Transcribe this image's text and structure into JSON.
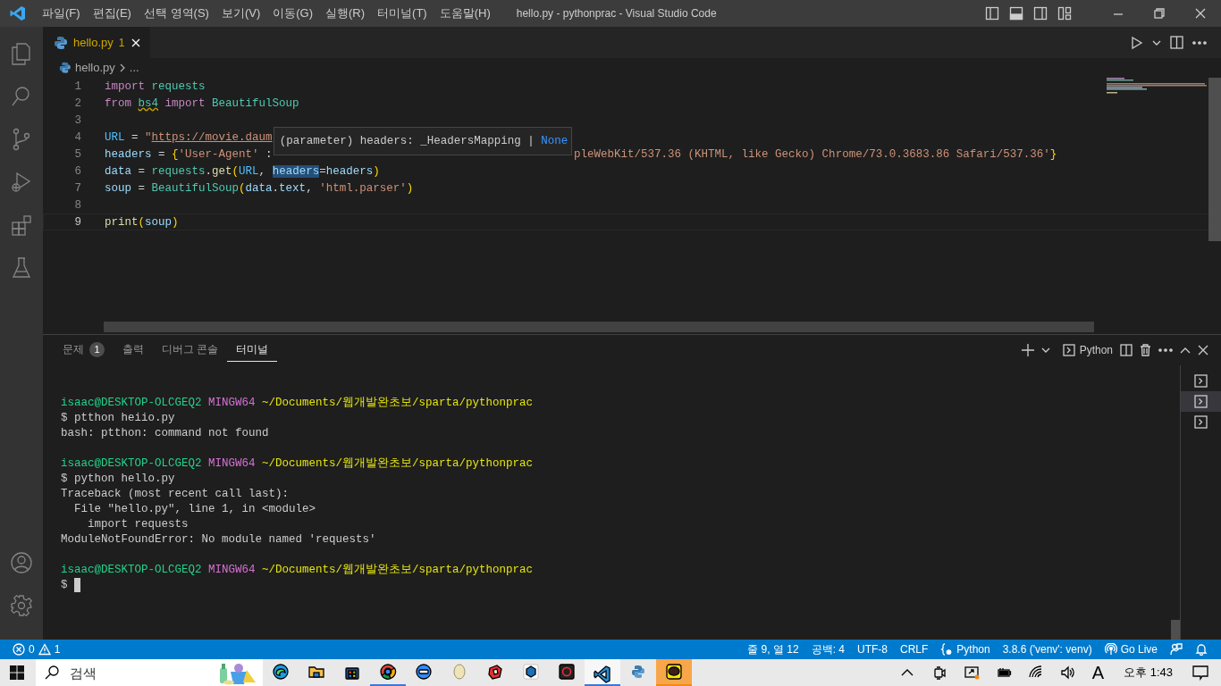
{
  "title_bar": {
    "menus": [
      "파일(F)",
      "편집(E)",
      "선택 영역(S)",
      "보기(V)",
      "이동(G)",
      "실행(R)",
      "터미널(T)",
      "도움말(H)"
    ],
    "title": "hello.py - pythonprac - Visual Studio Code"
  },
  "activity_bar": {
    "items": [
      {
        "kind": "files"
      },
      {
        "kind": "search"
      },
      {
        "kind": "source_control"
      },
      {
        "kind": "run_debug"
      },
      {
        "kind": "extensions"
      },
      {
        "kind": "testing"
      }
    ],
    "bottom": [
      {
        "kind": "account"
      },
      {
        "kind": "settings"
      }
    ]
  },
  "editor": {
    "tabs": [
      {
        "label": "hello.py",
        "problems": "1",
        "selected": true
      }
    ],
    "breadcrumb": [
      "hello.py",
      "..."
    ],
    "lines": [
      {
        "number": "1",
        "current": false,
        "tokens": [
          {
            "kind": "keyword",
            "t": "import "
          },
          {
            "kind": "type",
            "t": "requests"
          }
        ]
      },
      {
        "number": "2",
        "current": false,
        "tokens": [
          {
            "kind": "keyword",
            "t": "from "
          },
          {
            "kind": "type_warning",
            "t": "bs4"
          },
          {
            "kind": "keyword",
            "t": " import "
          },
          {
            "kind": "type",
            "t": "BeautifulSoup"
          }
        ]
      },
      {
        "number": "3",
        "current": false
      },
      {
        "number": "4",
        "current": false,
        "tokens": [
          {
            "kind": "const",
            "t": "URL"
          },
          {
            "kind": "plain",
            "t": " = "
          },
          {
            "kind": "string",
            "t": "\""
          },
          {
            "kind": "url",
            "t": "https://movie.daum"
          }
        ]
      },
      {
        "number": "5",
        "current": false,
        "tokens": [
          {
            "kind": "var",
            "t": "headers"
          },
          {
            "kind": "plain",
            "t": " = "
          },
          {
            "kind": "bracket",
            "t": "{"
          },
          {
            "kind": "string",
            "t": "'User-Agent'"
          },
          {
            "kind": "plain",
            "t": " :"
          }
        ],
        "tail": [
          {
            "kind": "string",
            "t": "pleWebKit/537.36 (KHTML, like Gecko) Chrome/73.0.3683.86 Safari/537.36'"
          },
          {
            "kind": "bracket",
            "t": "}"
          }
        ]
      },
      {
        "number": "6",
        "current": false,
        "tokens": [
          {
            "kind": "var",
            "t": "data"
          },
          {
            "kind": "plain",
            "t": " = "
          },
          {
            "kind": "type",
            "t": "requests"
          },
          {
            "kind": "plain",
            "t": "."
          },
          {
            "kind": "function",
            "t": "get"
          },
          {
            "kind": "bracket",
            "t": "("
          },
          {
            "kind": "const",
            "t": "URL"
          },
          {
            "kind": "plain",
            "t": ", "
          },
          {
            "kind": "highlight",
            "t": "headers"
          },
          {
            "kind": "plain",
            "t": "="
          },
          {
            "kind": "var",
            "t": "headers"
          },
          {
            "kind": "bracket",
            "t": ")"
          }
        ]
      },
      {
        "number": "7",
        "current": false,
        "tokens": [
          {
            "kind": "var",
            "t": "soup"
          },
          {
            "kind": "plain",
            "t": " = "
          },
          {
            "kind": "type",
            "t": "BeautifulSoup"
          },
          {
            "kind": "bracket",
            "t": "("
          },
          {
            "kind": "var",
            "t": "data"
          },
          {
            "kind": "plain",
            "t": "."
          },
          {
            "kind": "var",
            "t": "text"
          },
          {
            "kind": "plain",
            "t": ", "
          },
          {
            "kind": "string",
            "t": "'html.parser'"
          },
          {
            "kind": "bracket",
            "t": ")"
          }
        ]
      },
      {
        "number": "8",
        "current": false
      },
      {
        "number": "9",
        "current": true,
        "tokens": [
          {
            "kind": "function",
            "t": "print"
          },
          {
            "kind": "bracket",
            "t": "("
          },
          {
            "kind": "var",
            "t": "soup"
          },
          {
            "kind": "bracket",
            "t": ")"
          }
        ]
      }
    ],
    "hover": {
      "signature": "(parameter) headers: _HeadersMapping | ",
      "type": "None"
    }
  },
  "panel": {
    "tabs": [
      {
        "label": "문제",
        "badge": "1",
        "selected": false
      },
      {
        "label": "출력",
        "selected": false
      },
      {
        "label": "디버그 콘솔",
        "selected": false
      },
      {
        "label": "터미널",
        "selected": true
      }
    ],
    "profile": "Python",
    "terminal_lines": [
      {
        "segments": [
          {
            "kind": "user",
            "t": "isaac@DESKTOP-OLCGEQ2"
          },
          {
            "kind": "host",
            "t": " MINGW64"
          },
          {
            "kind": "path",
            "t": " ~/Documents/웹개발완초보/sparta/pythonprac"
          }
        ]
      },
      {
        "segments": [
          {
            "kind": "plain",
            "t": "$ ptthon heiio.py"
          }
        ]
      },
      {
        "segments": [
          {
            "kind": "plain",
            "t": "bash: ptthon: command not found"
          }
        ]
      },
      {
        "after_blank": true,
        "segments": [
          {
            "kind": "user",
            "t": "isaac@DESKTOP-OLCGEQ2"
          },
          {
            "kind": "host",
            "t": " MINGW64"
          },
          {
            "kind": "path",
            "t": " ~/Documents/웹개발완초보/sparta/pythonprac"
          }
        ]
      },
      {
        "segments": [
          {
            "kind": "plain",
            "t": "$ python hello.py"
          }
        ]
      },
      {
        "segments": [
          {
            "kind": "plain",
            "t": "Traceback (most recent call last):"
          }
        ]
      },
      {
        "segments": [
          {
            "kind": "plain",
            "t": "  File \"hello.py\", line 1, in <module>"
          }
        ]
      },
      {
        "segments": [
          {
            "kind": "plain",
            "t": "    import requests"
          }
        ]
      },
      {
        "segments": [
          {
            "kind": "plain",
            "t": "ModuleNotFoundError: No module named 'requests'"
          }
        ]
      },
      {
        "after_blank": true,
        "segments": [
          {
            "kind": "user",
            "t": "isaac@DESKTOP-OLCGEQ2"
          },
          {
            "kind": "host",
            "t": " MINGW64"
          },
          {
            "kind": "path",
            "t": " ~/Documents/웹개발완초보/sparta/pythonprac"
          }
        ]
      },
      {
        "segments": [
          {
            "kind": "plain",
            "t": "$"
          }
        ],
        "cursor": true
      }
    ],
    "terminals": [
      {
        "selected": false
      },
      {
        "selected": true
      },
      {
        "selected": false
      }
    ]
  },
  "status_bar": {
    "left": [
      {
        "kind": "errors",
        "text": "0"
      },
      {
        "kind": "warnings",
        "text": "1"
      }
    ],
    "right": [
      {
        "kind": "text",
        "text": "줄 9, 열 12"
      },
      {
        "kind": "text",
        "text": "공백: 4"
      },
      {
        "kind": "text",
        "text": "UTF-8"
      },
      {
        "kind": "text",
        "text": "CRLF"
      },
      {
        "kind": "language",
        "text": "Python"
      },
      {
        "kind": "text",
        "text": "3.8.6 ('venv': venv)"
      },
      {
        "kind": "golive",
        "text": "Go Live"
      },
      {
        "kind": "feedback"
      },
      {
        "kind": "bell"
      }
    ]
  },
  "taskbar": {
    "search_placeholder": "검색",
    "apps": [
      {
        "kind": "edge",
        "running": false,
        "active": false
      },
      {
        "kind": "folder",
        "running": false,
        "active": false
      },
      {
        "kind": "store",
        "running": false,
        "active": false
      },
      {
        "kind": "chrome",
        "running": true,
        "active": false
      },
      {
        "kind": "zoom",
        "running": false,
        "active": false
      },
      {
        "kind": "egg",
        "running": false,
        "active": false
      },
      {
        "kind": "sketch",
        "running": false,
        "active": false
      },
      {
        "kind": "cube",
        "running": false,
        "active": false
      },
      {
        "kind": "camera",
        "running": false,
        "active": false
      },
      {
        "kind": "vscode",
        "running": true,
        "active": true
      },
      {
        "kind": "python",
        "running": false,
        "active": false
      },
      {
        "kind": "chat",
        "running": true,
        "active": false,
        "attention": true
      }
    ],
    "tray": [
      {
        "kind": "chevron"
      },
      {
        "kind": "meet"
      },
      {
        "kind": "sync"
      },
      {
        "kind": "battery"
      },
      {
        "kind": "wifi"
      },
      {
        "kind": "volume"
      }
    ],
    "ime": "A",
    "clock": "오후 1:43"
  }
}
